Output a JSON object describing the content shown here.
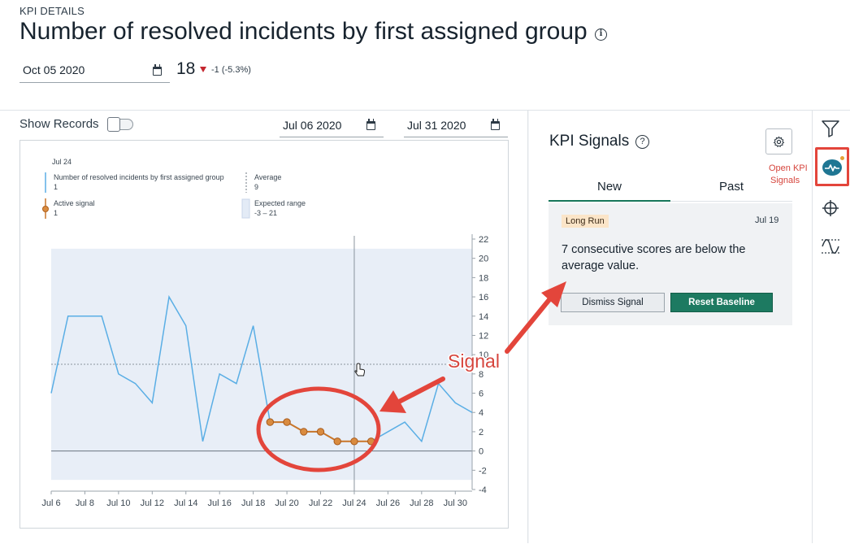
{
  "header": {
    "section_label": "KPI DETAILS",
    "title": "Number of resolved incidents by first assigned group",
    "date": "Oct 05 2020",
    "score": "18",
    "delta": "-1 (-5.3%)"
  },
  "toolbar": {
    "show_records_label": "Show Records",
    "show_records_on": false,
    "range_start": "Jul 06 2020",
    "range_end": "Jul 31 2020"
  },
  "legend": {
    "cursor_date": "Jul 24",
    "series_label": "Number of resolved incidents by first assigned group",
    "series_value": "1",
    "average_label": "Average",
    "average_value": "9",
    "signal_label": "Active signal",
    "signal_value": "1",
    "range_label": "Expected range",
    "range_value": "-3 – 21"
  },
  "chart_data": {
    "type": "line",
    "x_tick_labels": [
      "Jul 6",
      "Jul 8",
      "Jul 10",
      "Jul 12",
      "Jul 14",
      "Jul 16",
      "Jul 18",
      "Jul 20",
      "Jul 22",
      "Jul 24",
      "Jul 26",
      "Jul 28",
      "Jul 30"
    ],
    "y_ticks": [
      -4,
      -2,
      0,
      2,
      4,
      6,
      8,
      10,
      12,
      14,
      16,
      18,
      20,
      22
    ],
    "ylim": [
      -4,
      22
    ],
    "x_day_range": [
      6,
      31
    ],
    "expected_range": [
      -3,
      21
    ],
    "average": 9,
    "cursor_day": 24,
    "series": [
      {
        "days": [
          6,
          7,
          8,
          9,
          10,
          11,
          12,
          13,
          14,
          15,
          16,
          17,
          18,
          19,
          20,
          21,
          22,
          23,
          24,
          25,
          26,
          27,
          28,
          29,
          30,
          31
        ],
        "values": [
          6,
          14,
          14,
          14,
          8,
          7,
          5,
          16,
          13,
          1,
          8,
          7,
          13,
          3,
          3,
          2,
          2,
          1,
          1,
          1,
          2,
          3,
          1,
          7,
          5,
          4
        ],
        "color": "#5aaee5"
      },
      {
        "name": "Active signal",
        "days": [
          19,
          20,
          21,
          22,
          23,
          24,
          25
        ],
        "values": [
          3,
          3,
          2,
          2,
          1,
          1,
          1
        ],
        "color": "#c9762a"
      }
    ]
  },
  "signals_panel": {
    "title": "KPI Signals",
    "tabs": [
      "New",
      "Past"
    ],
    "active_tab": "New",
    "card": {
      "badge": "Long Run",
      "date": "Jul 19",
      "description": "7 consecutive scores are below the average value.",
      "dismiss_label": "Dismiss Signal",
      "reset_label": "Reset Baseline"
    }
  },
  "annotations": {
    "open_signals_line1": "Open KPI",
    "open_signals_line2": "Signals",
    "signal_callout": "Signal",
    "accent": "#e3453b"
  },
  "colors": {
    "series": "#5aaee5",
    "signal": "#c9762a",
    "expected_range": "#e8eef7",
    "primary_button": "#1d7a61",
    "badge": "#fbe5c8"
  }
}
